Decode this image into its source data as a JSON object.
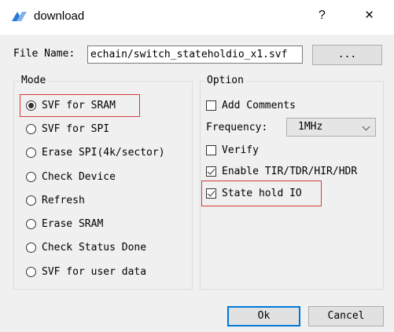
{
  "window": {
    "title": "download",
    "help_label": "?",
    "close_label": "×",
    "icon": "download-app-icon",
    "accent_color": "#0078d7",
    "highlight_color": "#d63c3c"
  },
  "file": {
    "label": "File Name:",
    "value": "echain/switch_stateholdio_x1.svf",
    "browse_label": "..."
  },
  "mode": {
    "title": "Mode",
    "selected": "SVF for SRAM",
    "options": [
      {
        "label": "SVF for SRAM",
        "checked": true
      },
      {
        "label": "SVF for SPI",
        "checked": false
      },
      {
        "label": "Erase SPI(4k/sector)",
        "checked": false
      },
      {
        "label": "Check Device",
        "checked": false
      },
      {
        "label": "Refresh",
        "checked": false
      },
      {
        "label": "Erase SRAM",
        "checked": false
      },
      {
        "label": "Check Status Done",
        "checked": false
      },
      {
        "label": "SVF for user data",
        "checked": false
      }
    ]
  },
  "option": {
    "title": "Option",
    "add_comments": {
      "label": "Add Comments",
      "checked": false
    },
    "frequency": {
      "label": "Frequency:",
      "value": "1MHz"
    },
    "verify": {
      "label": "Verify",
      "checked": false
    },
    "enable_tir": {
      "label": "Enable TIR/TDR/HIR/HDR",
      "checked": true
    },
    "state_hold": {
      "label": "State hold IO",
      "checked": true
    }
  },
  "buttons": {
    "ok": "Ok",
    "cancel": "Cancel"
  }
}
